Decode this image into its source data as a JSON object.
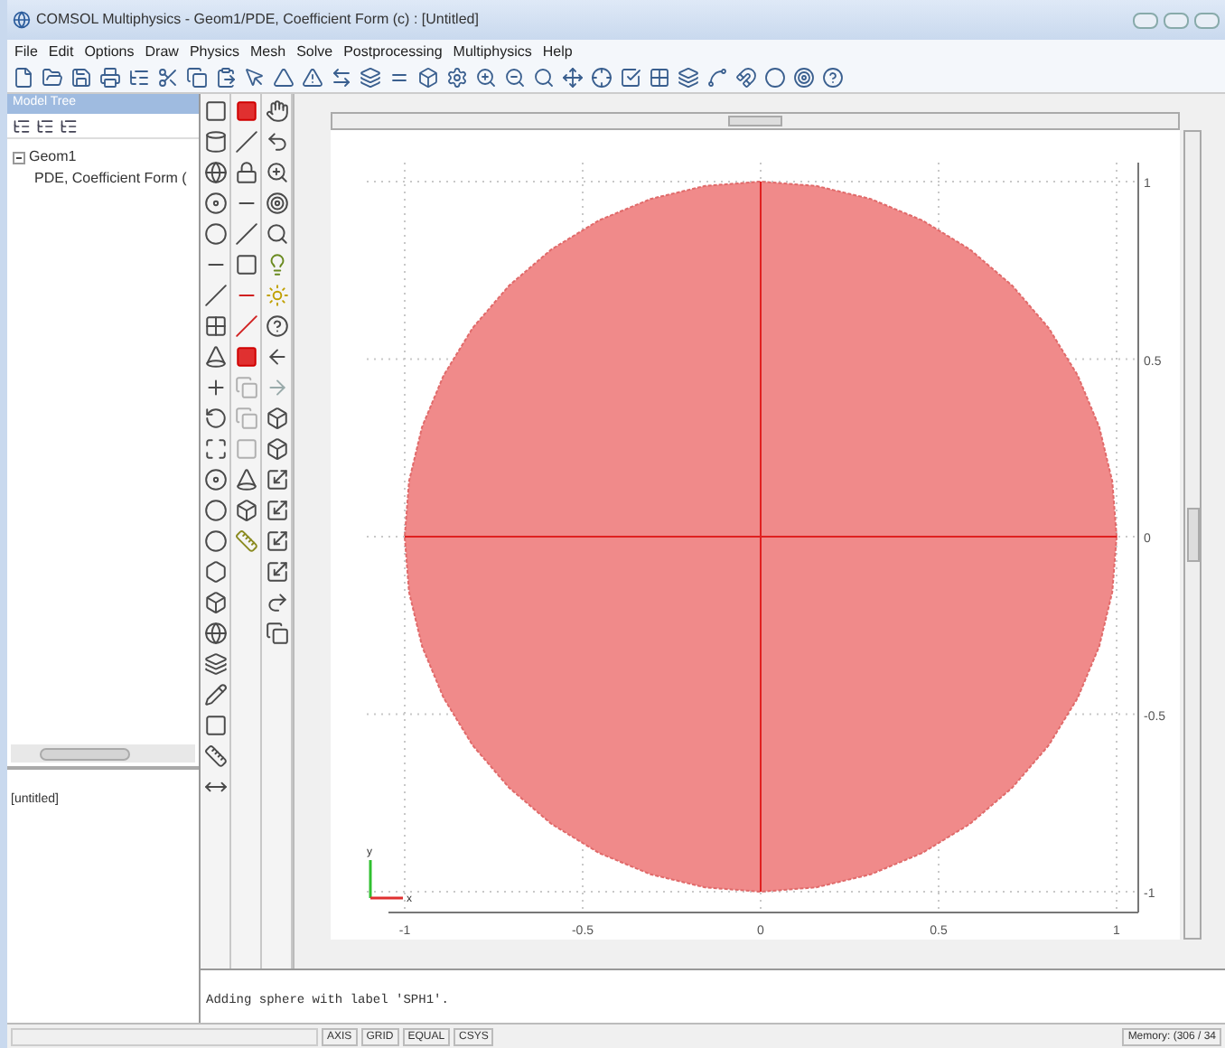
{
  "window": {
    "title": "COMSOL Multiphysics - Geom1/PDE, Coefficient Form (c) : [Untitled]"
  },
  "menu": [
    "File",
    "Edit",
    "Options",
    "Draw",
    "Physics",
    "Mesh",
    "Solve",
    "Postprocessing",
    "Multiphysics",
    "Help"
  ],
  "model_tree": {
    "title": "Model Tree",
    "items": [
      {
        "label": "Geom1",
        "expanded": true,
        "children": [
          {
            "label": "PDE, Coefficient Form ("
          }
        ]
      }
    ]
  },
  "properties": {
    "text": "[untitled]"
  },
  "plot": {
    "xticks": [
      "-1",
      "-0.5",
      "0",
      "0.5",
      "1"
    ],
    "yticks": [
      "1",
      "0.5",
      "0",
      "-0.5",
      "-1"
    ],
    "triad_labels": [
      "y",
      "x"
    ]
  },
  "log": {
    "message": "Adding sphere with label 'SPH1'."
  },
  "status_bar": {
    "buttons": [
      "AXIS",
      "GRID",
      "EQUAL",
      "CSYS"
    ],
    "memory": "Memory: (306 / 34"
  }
}
